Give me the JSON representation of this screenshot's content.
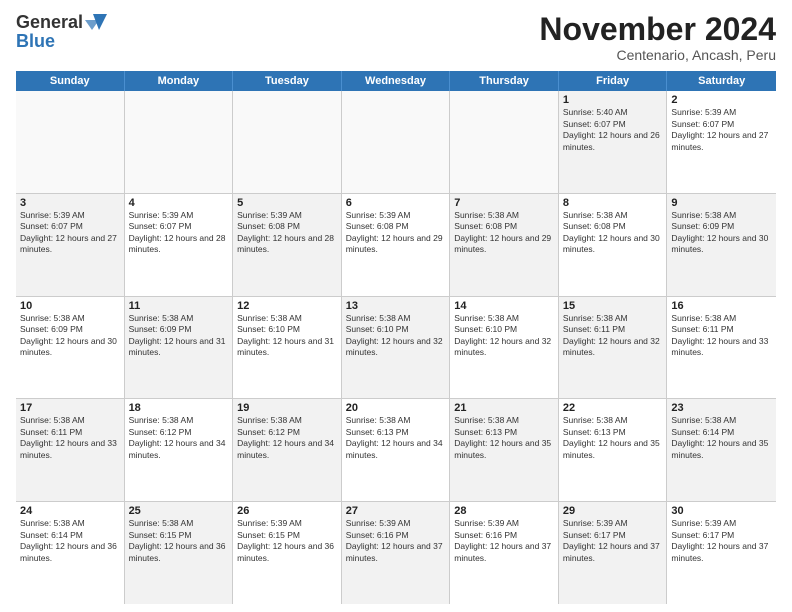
{
  "logo": {
    "general": "General",
    "blue": "Blue"
  },
  "title": "November 2024",
  "subtitle": "Centenario, Ancash, Peru",
  "header_days": [
    "Sunday",
    "Monday",
    "Tuesday",
    "Wednesday",
    "Thursday",
    "Friday",
    "Saturday"
  ],
  "weeks": [
    [
      {
        "day": "",
        "empty": true
      },
      {
        "day": "",
        "empty": true
      },
      {
        "day": "",
        "empty": true
      },
      {
        "day": "",
        "empty": true
      },
      {
        "day": "",
        "empty": true
      },
      {
        "day": "1",
        "text": "Sunrise: 5:40 AM\nSunset: 6:07 PM\nDaylight: 12 hours and 26 minutes.",
        "shaded": true
      },
      {
        "day": "2",
        "text": "Sunrise: 5:39 AM\nSunset: 6:07 PM\nDaylight: 12 hours and 27 minutes.",
        "shaded": false
      }
    ],
    [
      {
        "day": "3",
        "text": "Sunrise: 5:39 AM\nSunset: 6:07 PM\nDaylight: 12 hours and 27 minutes.",
        "shaded": true
      },
      {
        "day": "4",
        "text": "Sunrise: 5:39 AM\nSunset: 6:07 PM\nDaylight: 12 hours and 28 minutes.",
        "shaded": false
      },
      {
        "day": "5",
        "text": "Sunrise: 5:39 AM\nSunset: 6:08 PM\nDaylight: 12 hours and 28 minutes.",
        "shaded": true
      },
      {
        "day": "6",
        "text": "Sunrise: 5:39 AM\nSunset: 6:08 PM\nDaylight: 12 hours and 29 minutes.",
        "shaded": false
      },
      {
        "day": "7",
        "text": "Sunrise: 5:38 AM\nSunset: 6:08 PM\nDaylight: 12 hours and 29 minutes.",
        "shaded": true
      },
      {
        "day": "8",
        "text": "Sunrise: 5:38 AM\nSunset: 6:08 PM\nDaylight: 12 hours and 30 minutes.",
        "shaded": false
      },
      {
        "day": "9",
        "text": "Sunrise: 5:38 AM\nSunset: 6:09 PM\nDaylight: 12 hours and 30 minutes.",
        "shaded": true
      }
    ],
    [
      {
        "day": "10",
        "text": "Sunrise: 5:38 AM\nSunset: 6:09 PM\nDaylight: 12 hours and 30 minutes.",
        "shaded": false
      },
      {
        "day": "11",
        "text": "Sunrise: 5:38 AM\nSunset: 6:09 PM\nDaylight: 12 hours and 31 minutes.",
        "shaded": true
      },
      {
        "day": "12",
        "text": "Sunrise: 5:38 AM\nSunset: 6:10 PM\nDaylight: 12 hours and 31 minutes.",
        "shaded": false
      },
      {
        "day": "13",
        "text": "Sunrise: 5:38 AM\nSunset: 6:10 PM\nDaylight: 12 hours and 32 minutes.",
        "shaded": true
      },
      {
        "day": "14",
        "text": "Sunrise: 5:38 AM\nSunset: 6:10 PM\nDaylight: 12 hours and 32 minutes.",
        "shaded": false
      },
      {
        "day": "15",
        "text": "Sunrise: 5:38 AM\nSunset: 6:11 PM\nDaylight: 12 hours and 32 minutes.",
        "shaded": true
      },
      {
        "day": "16",
        "text": "Sunrise: 5:38 AM\nSunset: 6:11 PM\nDaylight: 12 hours and 33 minutes.",
        "shaded": false
      }
    ],
    [
      {
        "day": "17",
        "text": "Sunrise: 5:38 AM\nSunset: 6:11 PM\nDaylight: 12 hours and 33 minutes.",
        "shaded": true
      },
      {
        "day": "18",
        "text": "Sunrise: 5:38 AM\nSunset: 6:12 PM\nDaylight: 12 hours and 34 minutes.",
        "shaded": false
      },
      {
        "day": "19",
        "text": "Sunrise: 5:38 AM\nSunset: 6:12 PM\nDaylight: 12 hours and 34 minutes.",
        "shaded": true
      },
      {
        "day": "20",
        "text": "Sunrise: 5:38 AM\nSunset: 6:13 PM\nDaylight: 12 hours and 34 minutes.",
        "shaded": false
      },
      {
        "day": "21",
        "text": "Sunrise: 5:38 AM\nSunset: 6:13 PM\nDaylight: 12 hours and 35 minutes.",
        "shaded": true
      },
      {
        "day": "22",
        "text": "Sunrise: 5:38 AM\nSunset: 6:13 PM\nDaylight: 12 hours and 35 minutes.",
        "shaded": false
      },
      {
        "day": "23",
        "text": "Sunrise: 5:38 AM\nSunset: 6:14 PM\nDaylight: 12 hours and 35 minutes.",
        "shaded": true
      }
    ],
    [
      {
        "day": "24",
        "text": "Sunrise: 5:38 AM\nSunset: 6:14 PM\nDaylight: 12 hours and 36 minutes.",
        "shaded": false
      },
      {
        "day": "25",
        "text": "Sunrise: 5:38 AM\nSunset: 6:15 PM\nDaylight: 12 hours and 36 minutes.",
        "shaded": true
      },
      {
        "day": "26",
        "text": "Sunrise: 5:39 AM\nSunset: 6:15 PM\nDaylight: 12 hours and 36 minutes.",
        "shaded": false
      },
      {
        "day": "27",
        "text": "Sunrise: 5:39 AM\nSunset: 6:16 PM\nDaylight: 12 hours and 37 minutes.",
        "shaded": true
      },
      {
        "day": "28",
        "text": "Sunrise: 5:39 AM\nSunset: 6:16 PM\nDaylight: 12 hours and 37 minutes.",
        "shaded": false
      },
      {
        "day": "29",
        "text": "Sunrise: 5:39 AM\nSunset: 6:17 PM\nDaylight: 12 hours and 37 minutes.",
        "shaded": true
      },
      {
        "day": "30",
        "text": "Sunrise: 5:39 AM\nSunset: 6:17 PM\nDaylight: 12 hours and 37 minutes.",
        "shaded": false
      }
    ]
  ]
}
